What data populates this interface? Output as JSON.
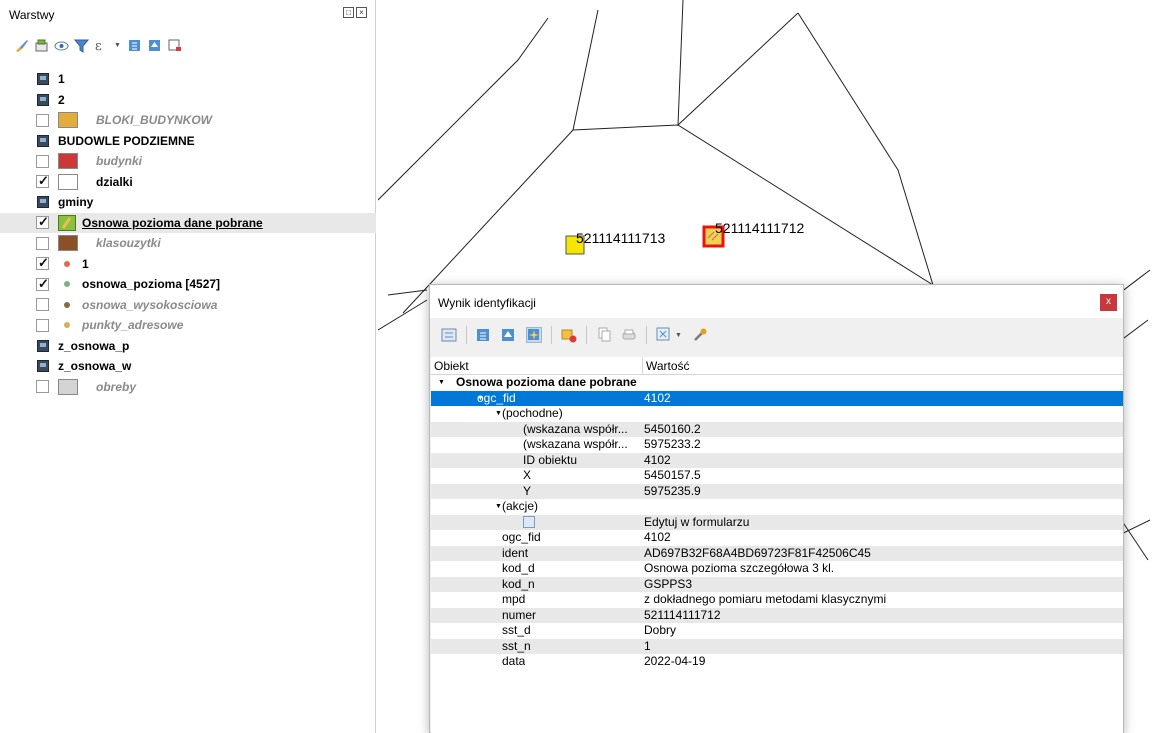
{
  "layers_panel": {
    "title": "Warstwy",
    "layers": [
      {
        "name": "1",
        "icon": "raster-group-icon",
        "checked": null
      },
      {
        "name": "2",
        "icon": "raster-group-icon",
        "checked": null
      },
      {
        "name": "BLOKI_BUDYNKOW",
        "icon": "polygon-swatch",
        "color": "#e3ad3c",
        "checked": false
      },
      {
        "name": "BUDOWLE PODZIEMNE",
        "icon": "raster-group-icon",
        "checked": null
      },
      {
        "name": "budynki",
        "icon": "polygon-swatch",
        "color": "#cc3838",
        "checked": false
      },
      {
        "name": "dzialki",
        "icon": "polygon-swatch",
        "color": "#ffffff",
        "checked": true
      },
      {
        "name": "gminy",
        "icon": "raster-group-icon",
        "checked": null
      },
      {
        "name": "Osnowa pozioma dane pobrane",
        "icon": "edit-icon",
        "checked": true
      },
      {
        "name": "klasouzytki",
        "icon": "polygon-swatch",
        "color": "#8b5025",
        "checked": false
      },
      {
        "name": "1",
        "icon": "point-dot",
        "color": "#e06a4a",
        "checked": true
      },
      {
        "name": "osnowa_pozioma [4527]",
        "icon": "point-dot",
        "color": "#7fb07f",
        "checked": true
      },
      {
        "name": "osnowa_wysokosciowa",
        "icon": "point-dot",
        "color": "#8a6a4a",
        "checked": false
      },
      {
        "name": "punkty_adresowe",
        "icon": "point-dot",
        "color": "#d6b25a",
        "checked": false
      },
      {
        "name": "z_osnowa_p",
        "icon": "raster-group-icon",
        "checked": null
      },
      {
        "name": "z_osnowa_w",
        "icon": "raster-group-icon",
        "checked": null
      },
      {
        "name": "obreby",
        "icon": "polygon-swatch",
        "color": "#d4d4d4",
        "checked": false
      }
    ]
  },
  "map": {
    "point_labels": [
      "521114111713",
      "521114111712"
    ]
  },
  "identify": {
    "title": "Wynik identyfikacji",
    "close_label": "x",
    "col_object": "Obiekt",
    "col_value": "Wartość",
    "rows": [
      {
        "key": "Osnowa pozioma dane pobrane",
        "value": "",
        "indent": 0,
        "arrow": "down",
        "bold": true
      },
      {
        "key": "ogc_fid",
        "value": "4102",
        "indent": 1,
        "arrow": "down",
        "selected": true
      },
      {
        "key": "(pochodne)",
        "value": "",
        "indent": 2,
        "arrow": "down"
      },
      {
        "key": "(wskazana współr...",
        "value": "5450160.2",
        "indent": 3
      },
      {
        "key": "(wskazana współr...",
        "value": "5975233.2",
        "indent": 3
      },
      {
        "key": "ID obiektu",
        "value": "4102",
        "indent": 3
      },
      {
        "key": "X",
        "value": "5450157.5",
        "indent": 3
      },
      {
        "key": "Y",
        "value": "5975235.9",
        "indent": 3
      },
      {
        "key": "(akcje)",
        "value": "",
        "indent": 2,
        "arrow": "down"
      },
      {
        "key": "",
        "value": "Edytuj w formularzu",
        "indent": 3,
        "form_icon": true
      },
      {
        "key": "ogc_fid",
        "value": "4102",
        "indent": 2
      },
      {
        "key": "ident",
        "value": "AD697B32F68A4BD69723F81F42506C45",
        "indent": 2
      },
      {
        "key": "kod_d",
        "value": "Osnowa pozioma szczegółowa 3 kl.",
        "indent": 2
      },
      {
        "key": "kod_n",
        "value": "GSPPS3",
        "indent": 2
      },
      {
        "key": "mpd",
        "value": "z dokładnego pomiaru metodami klasycznymi",
        "indent": 2
      },
      {
        "key": "numer",
        "value": "521114111712",
        "indent": 2
      },
      {
        "key": "sst_d",
        "value": "Dobry",
        "indent": 2
      },
      {
        "key": "sst_n",
        "value": "1",
        "indent": 2
      },
      {
        "key": "data",
        "value": "2022-04-19",
        "indent": 2
      }
    ]
  }
}
